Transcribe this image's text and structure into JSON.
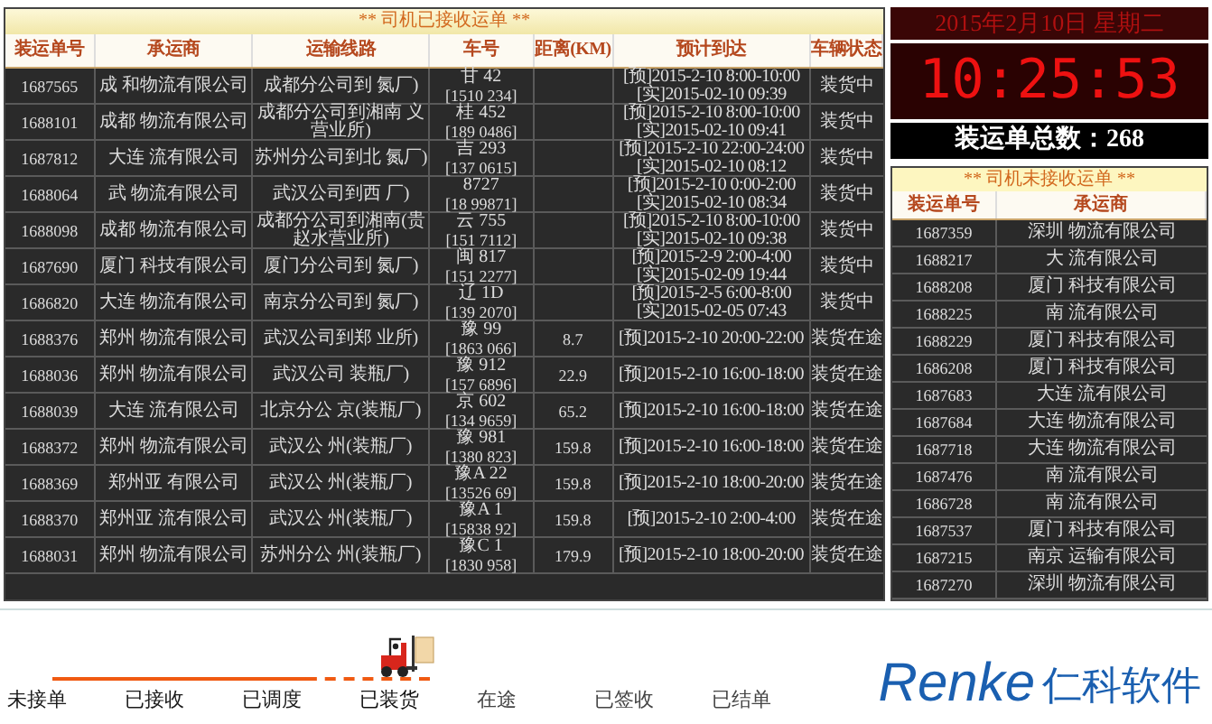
{
  "accepted_table": {
    "title": "** 司机已接收运单 **",
    "columns": [
      "装运单号",
      "承运商",
      "运输线路",
      "车号",
      "距离(KM)",
      "预计到达",
      "车辆状态"
    ],
    "rows": [
      {
        "id": "1687565",
        "carrier": "成 和物流有限公司",
        "route": "成都分公司到 氮厂)",
        "plate": "甘 42",
        "phone": "[1510 234]",
        "eta_plan": "[预]2015-2-10 8:00-10:00",
        "eta_actual": "[实]2015-02-10 09:39",
        "status": "装货中"
      },
      {
        "id": "1688101",
        "carrier": "成都 物流有限公司",
        "route": "成都分公司到湘南 义营业所)",
        "plate": "桂 452",
        "phone": "[189 0486]",
        "eta_plan": "[预]2015-2-10 8:00-10:00",
        "eta_actual": "[实]2015-02-10 09:41",
        "status": "装货中"
      },
      {
        "id": "1687812",
        "carrier": "大连 流有限公司",
        "route": "苏州分公司到北 氮厂)",
        "plate": "吉 293",
        "phone": "[137 0615]",
        "eta_plan": "[预]2015-2-10 22:00-24:00",
        "eta_actual": "[实]2015-02-10 08:12",
        "status": "装货中"
      },
      {
        "id": "1688064",
        "carrier": "武 物流有限公司",
        "route": "武汉公司到西 厂)",
        "plate": "8727",
        "phone": "[18 99871]",
        "eta_plan": "[预]2015-2-10 0:00-2:00",
        "eta_actual": "[实]2015-02-10 08:34",
        "status": "装货中"
      },
      {
        "id": "1688098",
        "carrier": "成都 物流有限公司",
        "route": "成都分公司到湘南(贵赵水营业所)",
        "plate": "云 755",
        "phone": "[151 7112]",
        "eta_plan": "[预]2015-2-10 8:00-10:00",
        "eta_actual": "[实]2015-02-10 09:38",
        "status": "装货中"
      },
      {
        "id": "1687690",
        "carrier": "厦门 科技有限公司",
        "route": "厦门分公司到 氮厂)",
        "plate": "闽 817",
        "phone": "[151 2277]",
        "eta_plan": "[预]2015-2-9 2:00-4:00",
        "eta_actual": "[实]2015-02-09 19:44",
        "status": "装货中"
      },
      {
        "id": "1686820",
        "carrier": "大连 物流有限公司",
        "route": "南京分公司到 氮厂)",
        "plate": "辽 1D",
        "phone": "[139 2070]",
        "eta_plan": "[预]2015-2-5 6:00-8:00",
        "eta_actual": "[实]2015-02-05 07:43",
        "status": "装货中"
      },
      {
        "id": "1688376",
        "carrier": "郑州 物流有限公司",
        "route": "武汉公司到郑 业所)",
        "plate": "豫 99",
        "phone": "[1863 066]",
        "distance": "8.7",
        "eta_plan": "[预]2015-2-10 20:00-22:00",
        "status": "装货在途"
      },
      {
        "id": "1688036",
        "carrier": "郑州 物流有限公司",
        "route": "武汉公司 装瓶厂)",
        "plate": "豫 912",
        "phone": "[157 6896]",
        "distance": "22.9",
        "eta_plan": "[预]2015-2-10 16:00-18:00",
        "status": "装货在途"
      },
      {
        "id": "1688039",
        "carrier": "大连 流有限公司",
        "route": "北京分公 京(装瓶厂)",
        "plate": "京 602",
        "phone": "[134 9659]",
        "distance": "65.2",
        "eta_plan": "[预]2015-2-10 16:00-18:00",
        "status": "装货在途"
      },
      {
        "id": "1688372",
        "carrier": "郑州 物流有限公司",
        "route": "武汉公 州(装瓶厂)",
        "plate": "豫 981",
        "phone": "[1380 823]",
        "distance": "159.8",
        "eta_plan": "[预]2015-2-10 16:00-18:00",
        "status": "装货在途"
      },
      {
        "id": "1688369",
        "carrier": "郑州亚 有限公司",
        "route": "武汉公 州(装瓶厂)",
        "plate": "豫A 22",
        "phone": "[13526 69]",
        "distance": "159.8",
        "eta_plan": "[预]2015-2-10 18:00-20:00",
        "status": "装货在途"
      },
      {
        "id": "1688370",
        "carrier": "郑州亚 流有限公司",
        "route": "武汉公 州(装瓶厂)",
        "plate": "豫A 1",
        "phone": "[15838 92]",
        "distance": "159.8",
        "eta_plan": "[预]2015-2-10 2:00-4:00",
        "status": "装货在途"
      },
      {
        "id": "1688031",
        "carrier": "郑州 物流有限公司",
        "route": "苏州分公 州(装瓶厂)",
        "plate": "豫C 1",
        "phone": "[1830 958]",
        "distance": "179.9",
        "eta_plan": "[预]2015-2-10 18:00-20:00",
        "status": "装货在途"
      }
    ]
  },
  "clock": {
    "date": "2015年2月10日 星期二",
    "time": "10:25:53"
  },
  "total": {
    "label": "装运单总数：",
    "value": "268"
  },
  "pending_table": {
    "title": "** 司机未接收运单 **",
    "columns": [
      "装运单号",
      "承运商"
    ],
    "rows": [
      {
        "id": "1687359",
        "carrier": "深圳 物流有限公司"
      },
      {
        "id": "1688217",
        "carrier": "大 流有限公司"
      },
      {
        "id": "1688208",
        "carrier": "厦门 科技有限公司"
      },
      {
        "id": "1688225",
        "carrier": "南 流有限公司"
      },
      {
        "id": "1688229",
        "carrier": "厦门 科技有限公司"
      },
      {
        "id": "1686208",
        "carrier": "厦门 科技有限公司"
      },
      {
        "id": "1687683",
        "carrier": "大连 流有限公司"
      },
      {
        "id": "1687684",
        "carrier": "大连 物流有限公司"
      },
      {
        "id": "1687718",
        "carrier": "大连 物流有限公司"
      },
      {
        "id": "1687476",
        "carrier": "南 流有限公司"
      },
      {
        "id": "1686728",
        "carrier": "南 流有限公司"
      },
      {
        "id": "1687537",
        "carrier": "厦门 科技有限公司"
      },
      {
        "id": "1687215",
        "carrier": "南京 运输有限公司"
      },
      {
        "id": "1687270",
        "carrier": "深圳 物流有限公司"
      }
    ]
  },
  "progress": {
    "steps": [
      {
        "label": "未接单",
        "done": true,
        "current": false
      },
      {
        "label": "已接收",
        "done": true,
        "current": false
      },
      {
        "label": "已调度",
        "done": true,
        "current": false
      },
      {
        "label": "已装货",
        "done": false,
        "current": true
      },
      {
        "label": "在途",
        "done": false,
        "current": false
      },
      {
        "label": "已签收",
        "done": false,
        "current": false
      },
      {
        "label": "已结单",
        "done": false,
        "current": false
      }
    ]
  },
  "logo": {
    "name": "Renke",
    "subtitle": "仁科软件"
  }
}
